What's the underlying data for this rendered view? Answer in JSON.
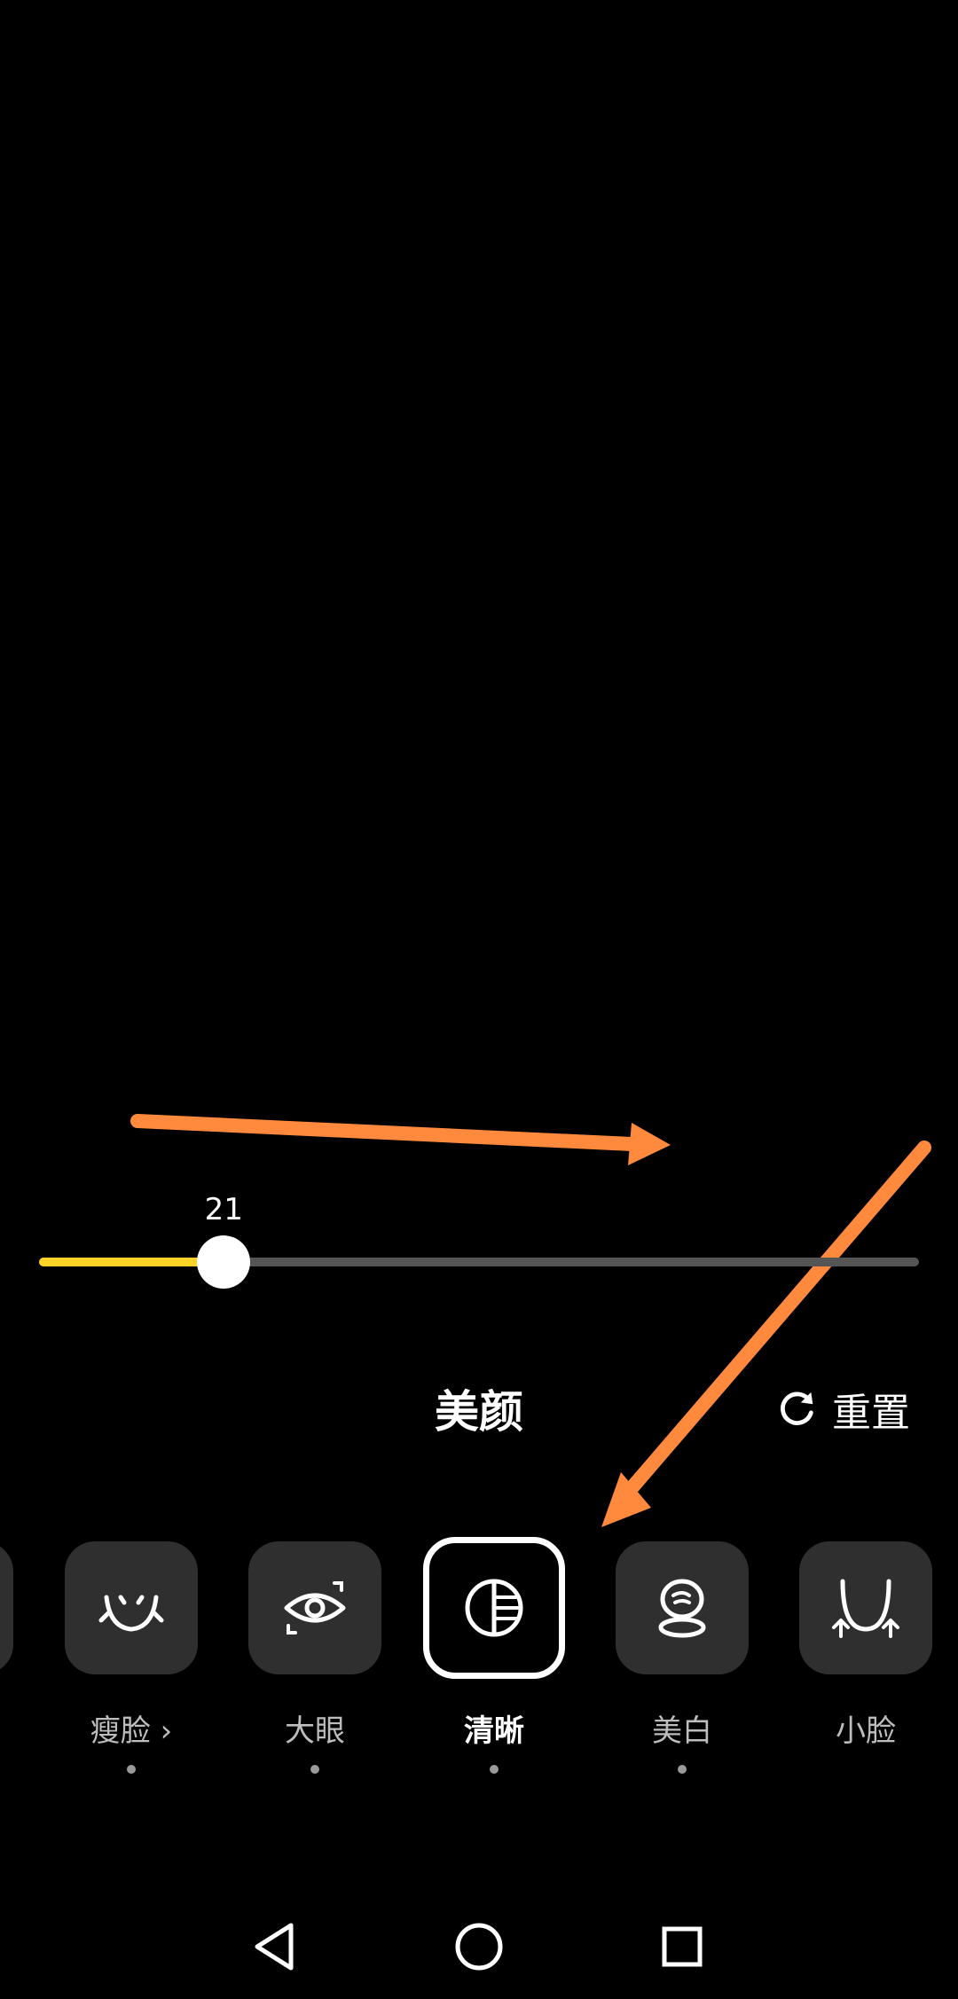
{
  "slider": {
    "value": 21,
    "value_label": "21",
    "max": 100,
    "fill_color": "#ffd426",
    "track_color": "#555555"
  },
  "panel": {
    "title": "美颜",
    "reset_label": "重置",
    "reset_icon": "refresh-icon"
  },
  "features": [
    {
      "label": "瘦脸 ›",
      "icon": "slim-face-icon",
      "selected": false,
      "has_dot": true
    },
    {
      "label": "大眼",
      "icon": "big-eye-icon",
      "selected": false,
      "has_dot": true
    },
    {
      "label": "清晰",
      "icon": "sharpness-icon",
      "selected": true,
      "has_dot": true
    },
    {
      "label": "美白",
      "icon": "whitening-icon",
      "selected": false,
      "has_dot": true
    },
    {
      "label": "小脸",
      "icon": "small-face-icon",
      "selected": false,
      "has_dot": false
    }
  ],
  "navbar": {
    "back_icon": "back-triangle-icon",
    "home_icon": "home-circle-icon",
    "recents_icon": "recents-square-icon"
  },
  "annotation_color": "#ff8a3d"
}
